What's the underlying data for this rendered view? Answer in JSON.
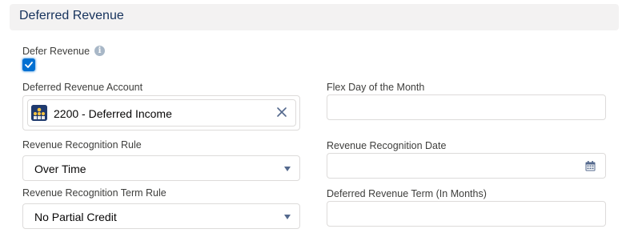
{
  "section": {
    "title": "Deferred Revenue"
  },
  "defer_revenue": {
    "label": "Defer Revenue",
    "info_icon": "info-icon",
    "checked": true
  },
  "deferred_account": {
    "label": "Deferred Revenue Account",
    "value": "2200 - Deferred Income",
    "icon": "account-hierarchy-icon",
    "clear_icon": "close-icon"
  },
  "flex_day": {
    "label": "Flex Day of the Month",
    "value": ""
  },
  "recognition_rule": {
    "label": "Revenue Recognition Rule",
    "value": "Over Time"
  },
  "recognition_date": {
    "label": "Revenue Recognition Date",
    "value": "",
    "icon": "calendar-icon"
  },
  "term_rule": {
    "label": "Revenue Recognition Term Rule",
    "value": "No Partial Credit"
  },
  "deferred_term": {
    "label": "Deferred Revenue Term (In Months)",
    "value": ""
  },
  "colors": {
    "accent": "#0070d2",
    "header_bg": "#f3f2f2",
    "border": "#dddbda",
    "title": "#16325c"
  }
}
